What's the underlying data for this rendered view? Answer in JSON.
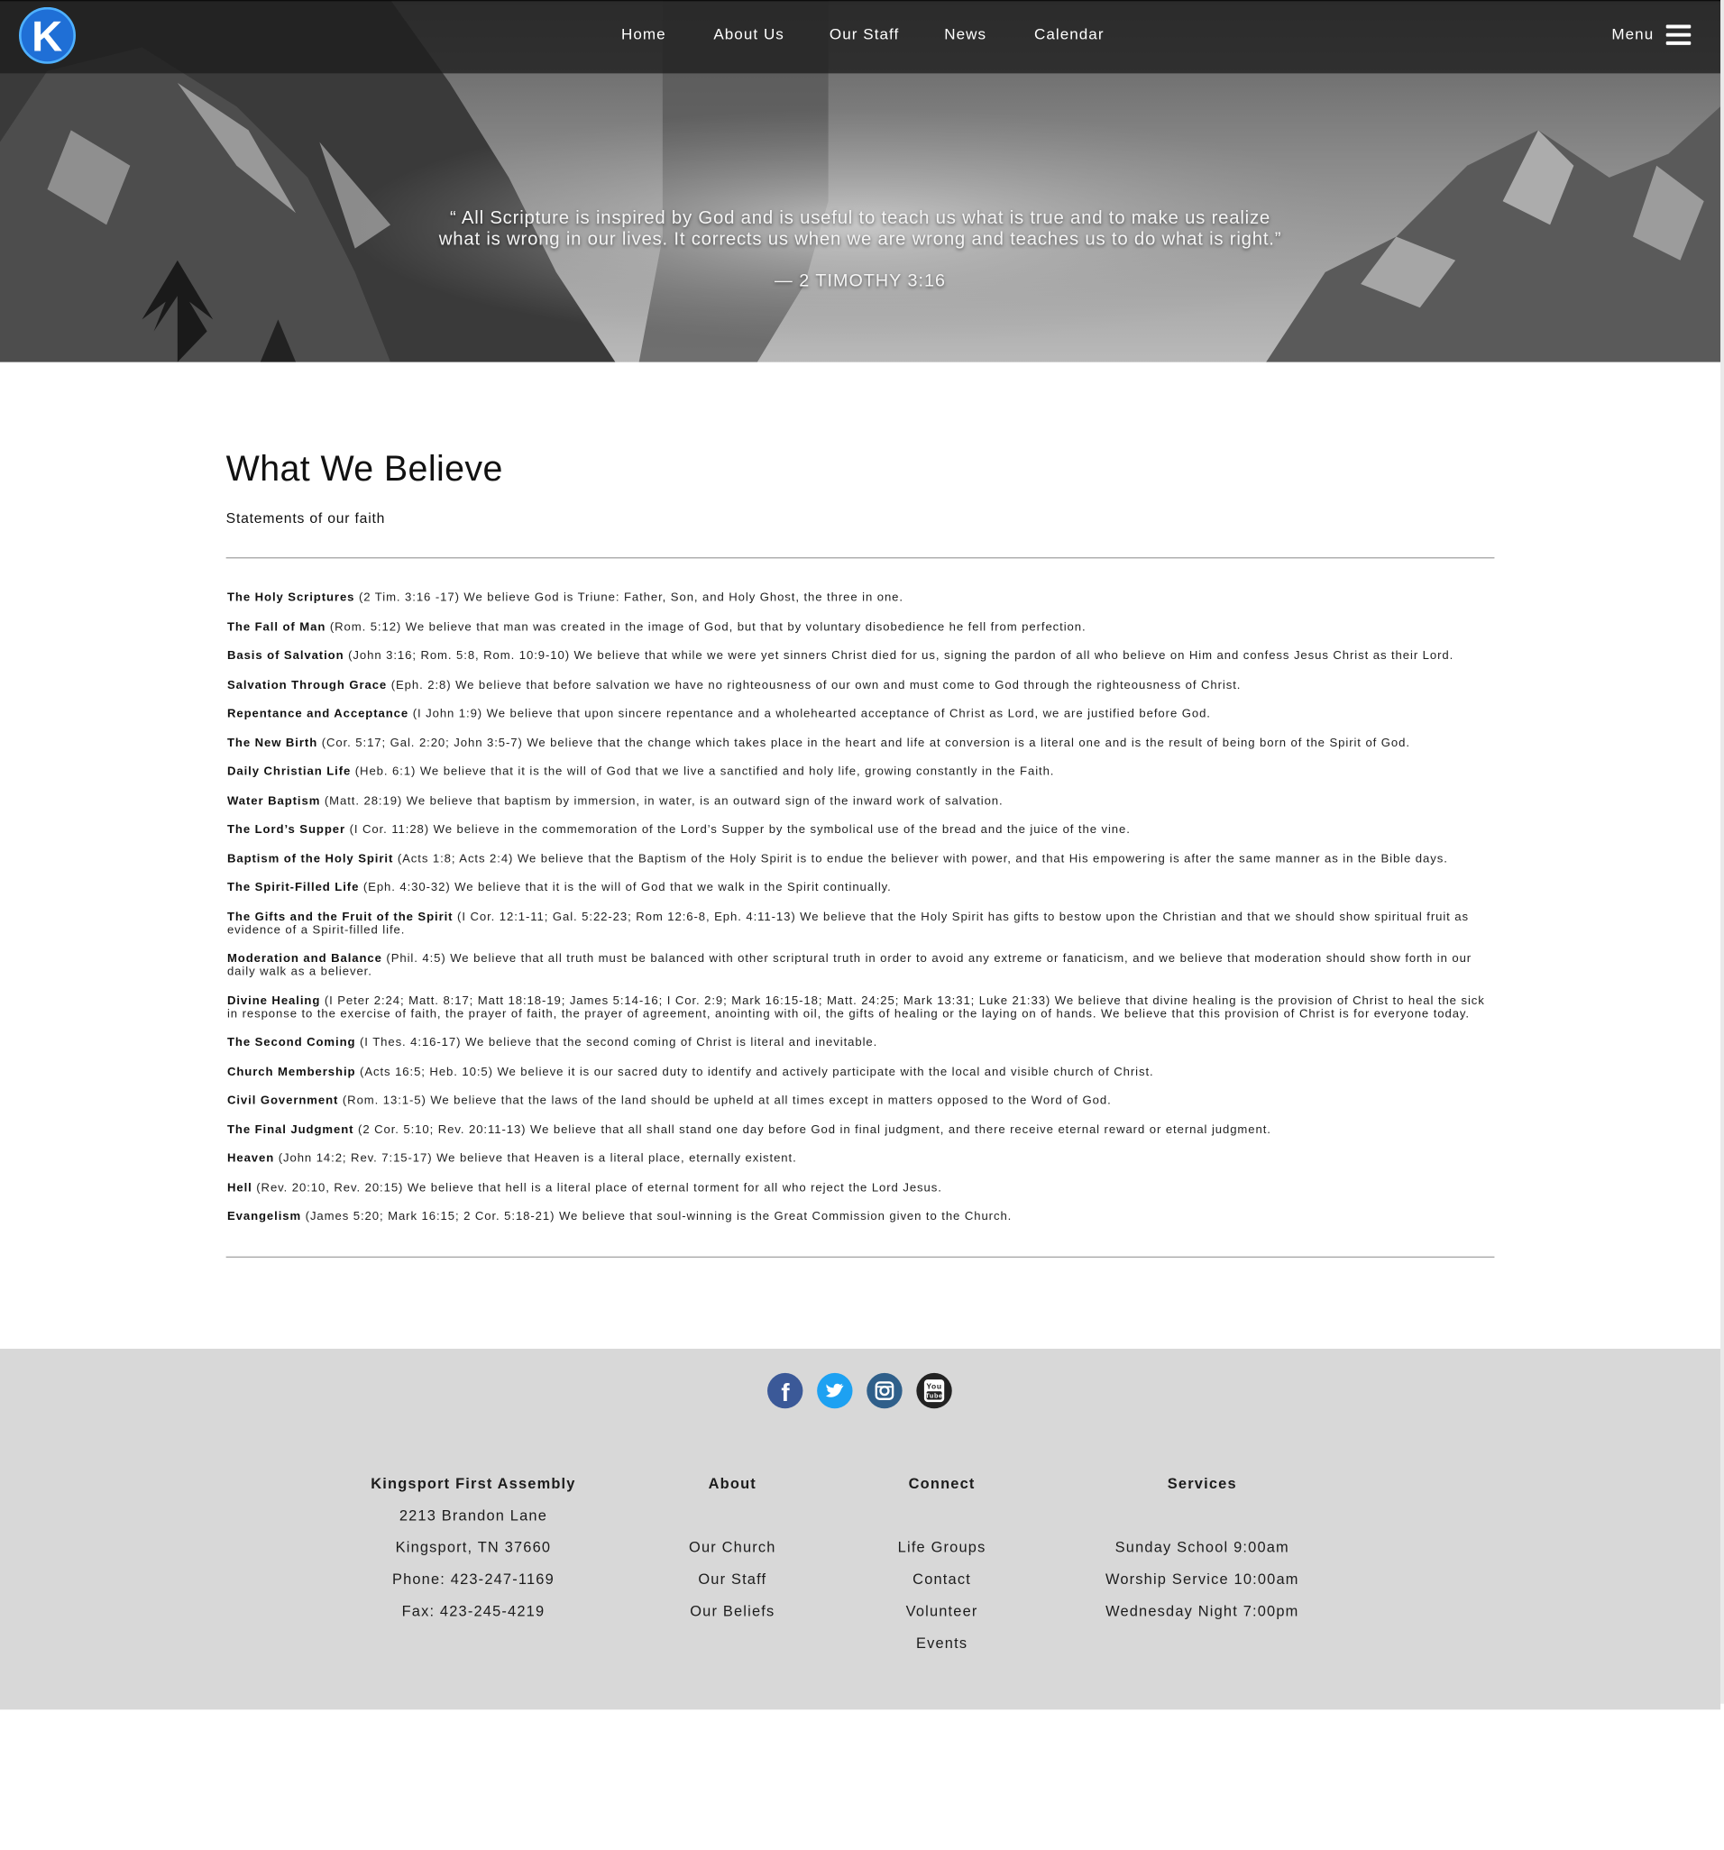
{
  "nav": {
    "logo_letter": "K",
    "links": [
      "Home",
      "About Us",
      "Our Staff",
      "News",
      "Calendar"
    ],
    "menu_label": "Menu"
  },
  "hero": {
    "quote_line1": "“ All Scripture is inspired by God and is useful to teach us what is true and to make us realize",
    "quote_line2": "what is wrong in our lives. It corrects us when we are wrong and teaches us to do what is right.”",
    "reference": "— 2 TIMOTHY 3:16"
  },
  "main": {
    "title": "What We Believe",
    "subtitle": "Statements of our faith",
    "beliefs": [
      {
        "name": "The Holy Scriptures",
        "text": " (2 Tim. 3:16 -17) We believe God is Triune: Father, Son, and Holy Ghost, the three in one."
      },
      {
        "name": "The Fall of Man",
        "text": " (Rom. 5:12) We believe that man was created in the image of God, but that by voluntary disobedience he fell from perfection."
      },
      {
        "name": "Basis of Salvation",
        "text": " (John 3:16; Rom. 5:8, Rom. 10:9-10) We believe that while we were yet sinners Christ died for us, signing the pardon of all who believe on Him and confess Jesus Christ as their Lord."
      },
      {
        "name": "Salvation Through Grace",
        "text": " (Eph. 2:8) We believe that before salvation we have no righteousness of our own and must come to God through the righteousness of Christ."
      },
      {
        "name": "Repentance and Acceptance",
        "text": " (I John 1:9) We believe that upon sincere repentance and a wholehearted acceptance of Christ as Lord, we are justified before God."
      },
      {
        "name": "The New Birth",
        "text": " (Cor. 5:17; Gal. 2:20; John 3:5-7) We believe that the change which takes place in the heart and life at conversion is a literal one and is the result of being born of the Spirit of God."
      },
      {
        "name": "Daily Christian Life",
        "text": " (Heb. 6:1) We believe that it is the will of God that we live a sanctified and holy life, growing constantly in the Faith."
      },
      {
        "name": "Water Baptism",
        "text": " (Matt. 28:19) We believe that baptism by immersion, in water, is an outward sign of the inward work of salvation."
      },
      {
        "name": "The Lord’s Supper",
        "text": " (I Cor. 11:28) We believe in the commemoration of the Lord’s Supper by the symbolical use of the bread and the juice of the vine."
      },
      {
        "name": "Baptism of the Holy Spirit",
        "text": " (Acts 1:8; Acts 2:4) We believe that the Baptism of the Holy Spirit is to endue the believer with power, and that His empowering is after the same manner as in the Bible days."
      },
      {
        "name": "The Spirit-Filled Life",
        "text": " (Eph. 4:30-32) We believe that it is the will of God that we walk in the Spirit continually."
      },
      {
        "name": "The Gifts and the Fruit of the Spirit",
        "text": " (I Cor. 12:1-11; Gal. 5:22-23; Rom 12:6-8, Eph. 4:11-13) We believe that the Holy Spirit has gifts to bestow upon the Christian and that we should show spiritual fruit as evidence of a Spirit-filled life."
      },
      {
        "name": "Moderation and Balance",
        "text": " (Phil. 4:5) We believe that all truth must be balanced with other scriptural truth in order to avoid any extreme or fanaticism, and we believe that moderation should show forth in our daily walk as a believer."
      },
      {
        "name": "Divine Healing",
        "text": " (I Peter 2:24; Matt. 8:17; Matt 18:18-19; James 5:14-16; I Cor. 2:9; Mark 16:15-18; Matt. 24:25; Mark 13:31; Luke 21:33) We believe that divine healing is the provision of Christ to heal the sick in response to the exercise of faith, the prayer of faith, the prayer of agreement, anointing with oil, the gifts of healing or the laying on of hands. We believe that this provision of Christ is for everyone today."
      },
      {
        "name": "The Second Coming",
        "text": " (I Thes. 4:16-17) We believe that the second coming of Christ is literal and inevitable."
      },
      {
        "name": "Church Membership",
        "text": " (Acts 16:5; Heb. 10:5) We believe it is our sacred duty to identify and actively participate with the local and visible church of Christ."
      },
      {
        "name": "Civil Government",
        "text": " (Rom. 13:1-5) We believe that the laws of the land should be upheld at all times except in matters opposed to the Word of God."
      },
      {
        "name": "The Final Judgment",
        "text": " (2 Cor. 5:10; Rev. 20:11-13) We believe that all shall stand one day before God in final judgment, and there receive eternal reward or eternal judgment."
      },
      {
        "name": "Heaven",
        "text": " (John 14:2; Rev. 7:15-17) We believe that Heaven is a literal place, eternally existent."
      },
      {
        "name": "Hell",
        "text": " (Rev. 20:10, Rev. 20:15) We believe that hell is a literal place of eternal torment for all who reject the Lord Jesus."
      },
      {
        "name": "Evangelism",
        "text": " (James 5:20; Mark 16:15; 2 Cor. 5:18-21) We believe that soul-winning is the Great Commission given to the Church."
      }
    ]
  },
  "footer": {
    "social": [
      {
        "icon": "facebook-icon",
        "glyph": "f",
        "color": "#3b5998"
      },
      {
        "icon": "twitter-icon",
        "glyph": "t",
        "color": "#1da1f2"
      },
      {
        "icon": "instagram-icon",
        "glyph": "",
        "color": "#2f5f8a"
      },
      {
        "icon": "youtube-icon",
        "glyph": "You Tube",
        "color": "#222222"
      }
    ],
    "church": {
      "title": "Kingsport First Assembly",
      "address1": "2213 Brandon Lane",
      "address2": "Kingsport, TN 37660",
      "phone": "Phone: 423-247-1169",
      "fax": "Fax: 423-245-4219"
    },
    "about": {
      "title": "About",
      "links": [
        "Our Church",
        "Our Staff",
        "Our Beliefs"
      ]
    },
    "connect": {
      "title": "Connect",
      "links": [
        "Life Groups",
        "Contact",
        "Volunteer",
        "Events"
      ]
    },
    "services": {
      "title": "Services",
      "items": [
        "Sunday School 9:00am",
        "Worship Service 10:00am",
        "Wednesday Night 7:00pm"
      ]
    }
  }
}
